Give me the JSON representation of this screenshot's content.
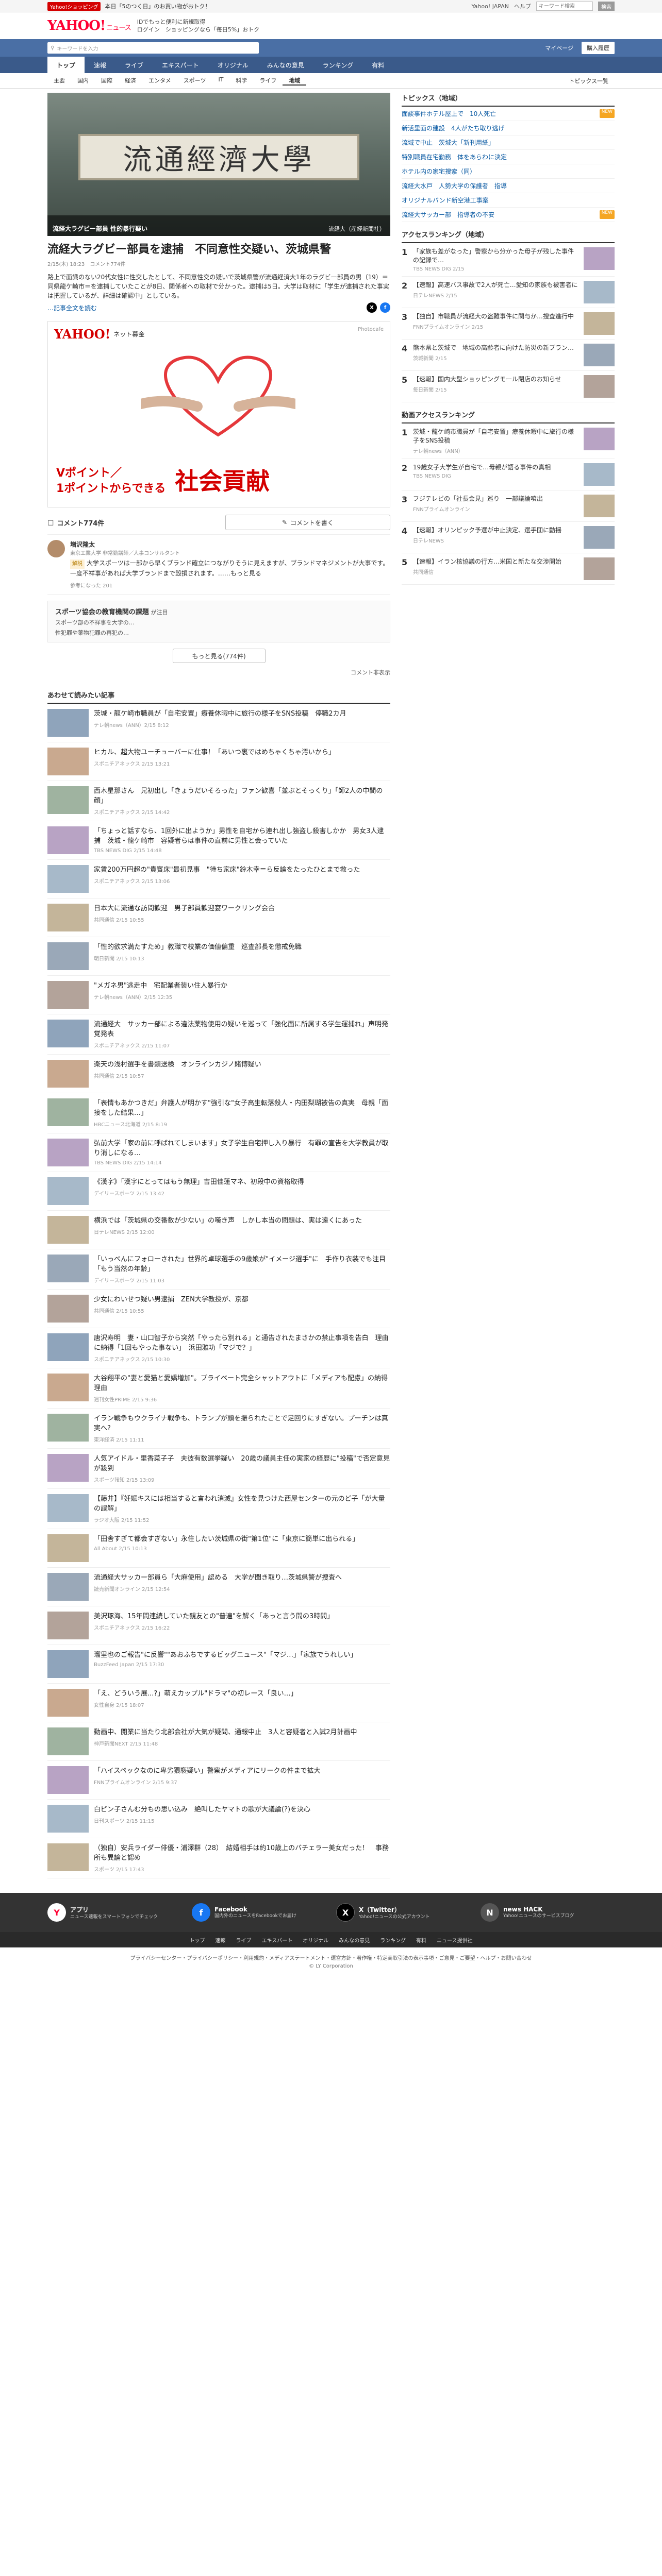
{
  "promo": {
    "tag": "Yahoo!ショッピング",
    "text": "本日「5のつく日」のお買い物がおトク！",
    "links": [
      "Yahoo! JAPAN",
      "ヘルプ"
    ],
    "search_placeholder": "キーワード検索",
    "search_button": "検索"
  },
  "masthead": {
    "logo": "YAHOO!",
    "logo_sub": "ニュース",
    "line1": "IDでもっと便利に新規取得",
    "line2": "ログイン　ショッピングなら「毎日5%」おトク"
  },
  "header": {
    "search_placeholder": "キーワードを入力",
    "mypage": "マイページ",
    "signup": "購入履歴"
  },
  "tabs": [
    "トップ",
    "速報",
    "ライブ",
    "エキスパート",
    "オリジナル",
    "みんなの意見",
    "ランキング",
    "有料"
  ],
  "subnav": {
    "items": [
      "主要",
      "国内",
      "国際",
      "経済",
      "エンタメ",
      "スポーツ",
      "IT",
      "科学",
      "ライフ",
      "地域"
    ],
    "right": "トピックス一覧"
  },
  "hero": {
    "sign": "流通經濟大學",
    "caption": "流経大ラグビー部員 性的暴行疑い",
    "credit": "流経大（産経新聞社）"
  },
  "article": {
    "title": "流経大ラグビー部員を逮捕　不同意性交疑い、茨城県警",
    "date": "2/15(木) 18:23",
    "comments": "コメント774件",
    "body": "路上で面識のない20代女性に性交したとして、不同意性交の疑いで茨城県警が流通経済大1年のラグビー部員の男（19）＝同県龍ケ崎市＝を逮捕していたことが8日、関係者への取材で分かった。逮捕は5日。大学は取材に「学生が逮捕された事実は把握しているが、詳細は確認中」としている。",
    "more": "…記事全文を読む"
  },
  "ad": {
    "logo": "YAHOO!",
    "sub": "ネット募金",
    "credit": "Photocafe",
    "point_label": "Vポイント／",
    "point_text": "1ポイントからできる",
    "big": "社会貢献"
  },
  "comments": {
    "label": "コメント774件",
    "button": "コメントを書く",
    "items": [
      {
        "name": "増沢隆太",
        "role": "東京工業大学 非常勤講師／人事コンサルタント",
        "tag": "解説",
        "body": "大学スポーツは一部から早くブランド確立につながりそうに見えますが、ブランドマネジメントが大事です。一度不祥事があれば大学ブランドまで毀損されます。……もっと見る",
        "likes": "参考になった 201"
      }
    ],
    "summary_title": "スポーツ協会の教育機関の課題",
    "summary_sub": "が注目",
    "summary_items": [
      "スポーツ部の不祥事を大学の…",
      "性犯罪や薬物犯罪の再犯の…"
    ],
    "more": "もっと見る(774件)",
    "hide": "コメント非表示"
  },
  "related": {
    "title": "あわせて読みたい記事",
    "items": [
      {
        "title": "茨城・龍ケ崎市職員が「自宅安置」療養休暇中に旅行の様子をSNS投稿　停職2カ月",
        "meta": "テレ朝news（ANN）2/15 8:12"
      },
      {
        "title": "ヒカル、超大物ユーチューバーに仕事！「あいつ裏ではめちゃくちゃ汚いから」",
        "meta": "スポニチアネックス 2/15 13:21"
      },
      {
        "title": "西木星那さん　兄初出し「きょうだいそろった」ファン歓喜「並ぶとそっくり」「師2人の中間の顔」",
        "meta": "スポニチアネックス 2/15 14:42"
      },
      {
        "title": "「ちょっと話すなら、1回外に出ようか」男性を自宅から連れ出し強盗し殺害しかか　男女3人逮捕　茨城・龍ケ崎市　容疑者らは事件の直前に男性と会っていた",
        "meta": "TBS NEWS DIG 2/15 14:48"
      },
      {
        "title": "家賃200万円超の\"貴賓床\"最初見事　\"待ち家床\"鈴木幸＝ら反論をたったひとまで救った",
        "meta": "スポニチアネックス 2/15 13:06"
      },
      {
        "title": "日本大に流通な訪問歓迎　男子部員歓迎宴ワークリング会合",
        "meta": "共同通信 2/15 10:55"
      },
      {
        "title": "「性的欲求満たすため」教職で校業の価値偏重　巡査部長を懲戒免職",
        "meta": "朝日新聞 2/15 10:13"
      },
      {
        "title": "\"メガネ男\"逃走中　宅配業者装い住人暴行か",
        "meta": "テレ朝news（ANN）2/15 12:35"
      },
      {
        "title": "流通経大　サッカー部による違法薬物使用の疑いを巡って「強化面に所属する学生運捕れ」声明発覚発表",
        "meta": "スポニチアネックス 2/15 11:07"
      },
      {
        "title": "楽天の浅村選手を書類送検　オンラインカジノ賭博疑い",
        "meta": "共同通信 2/15 10:57"
      },
      {
        "title": "「表情もあかつきだ」弁護人が明かす\"強引な\"女子高生転落殺人・内田梨瑚被告の真実　母親「面接をした結果…」",
        "meta": "HBCニュース北海道 2/15 8:19"
      },
      {
        "title": "弘前大学「家の前に呼ばれてしまいます」女子学生自宅押し入り暴行　有罪の宣告を大学教員が取り消しになる…",
        "meta": "TBS NEWS DIG 2/15 14:14"
      },
      {
        "title": "《漢字》「漢字にとってはもう無理」吉田佳蓮マネ、初段中の資格取得",
        "meta": "デイリースポーツ 2/15 13:42"
      },
      {
        "title": "横浜では「茨城県の交番数が少ない」の嘆き声　しかし本当の問題は、実は遠くにあった",
        "meta": "日テレNEWS 2/15 12:00"
      },
      {
        "title": "「いっぺんにフォローされた」世界的卓球選手の9歳娘が\"イメージ選手\"に　手作り衣装でも注目「もう当然の年齢」",
        "meta": "デイリースポーツ 2/15 11:03"
      },
      {
        "title": "少女にわいせつ疑い男逮捕　ZEN大学教授が、京都",
        "meta": "共同通信 2/15 10:55"
      },
      {
        "title": "唐沢寿明　妻・山口智子から突然「やったら別れる」と通告されたまさかの禁止事項を告白　理由に納得「1回もやった事ない」　浜田雅功「マジで？」",
        "meta": "スポニチアネックス 2/15 10:30"
      },
      {
        "title": "大谷翔平の\"妻と愛猫と愛嬌増加\"。プライベート完全シャットアウトに「メディアも配慮」の納得理由",
        "meta": "週刊女性PRIME 2/15 9:36"
      },
      {
        "title": "イラン戦争もウクライナ戦争も、トランプが頭を振られたことで足回りにすぎない。プーチンは真実へ?",
        "meta": "東洋経済 2/15 11:11"
      },
      {
        "title": "人気アイドル・里香菜子子　夫彼有数選挙疑い　20歳の議員主任の実家の経歴に\"投稿\"で否定意見が殺到",
        "meta": "スポーツ報知 2/15 13:09"
      },
      {
        "title": "【藤井】『妊娠キスには相当すると言われ消滅』女性を見つけた西屋センターの元のど子「が大量の誤解」",
        "meta": "ラジオ大阪 2/15 11:52"
      },
      {
        "title": "「田舎すぎて都会すぎない」永住したい茨城県の街\"第1位\"に「東京に簡単に出られる」",
        "meta": "All About 2/15 10:13"
      },
      {
        "title": "流通経大サッカー部員ら「大麻使用」認める　大学が聞き取り…茨城県警が捜査へ",
        "meta": "読売新聞オンライン 2/15 12:54"
      },
      {
        "title": "美沢琢海、15年間連続していた親友との\"普遍\"を解く「あっと言う間の3時間」",
        "meta": "スポニチアネックス 2/15 16:22"
      },
      {
        "title": "瑠里也のご報告\"に反響\"\"あおふちでするビッグニュース\"「マジ…」「家族でうれしい」",
        "meta": "BuzzFeed Japan 2/15 17:30"
      },
      {
        "title": "「え、どういう展...?」萌えカップル\"ドラマ\"の初レース「良い…」",
        "meta": "女性自身 2/15 18:07"
      },
      {
        "title": "動画中、開業に当たり北部会社が大気が疑問、通報中止　3人と容疑者と入試2月計画中",
        "meta": "神戸新聞NEXT 2/15 11:48"
      },
      {
        "title": "「ハイスペックなのに卑劣猥褻疑い」警察がメディアにリークの件まで拡大",
        "meta": "FNNプライムオンライン 2/15 9:37"
      },
      {
        "title": "白ピン子さんむ分もの思い込み　絶叫したヤマトの歌が大議論(?)を決心",
        "meta": "日刊スポーツ 2/15 11:15"
      },
      {
        "title": "（独自）安兵ライダー俳優・浦澤群（28）　結婚相手は約10歳上のバチェラー美女だった！　事務所も異論と認め",
        "meta": "スポーツ 2/15 17:43"
      }
    ]
  },
  "side": {
    "topics_title": "トピックス（地域）",
    "topics": [
      {
        "label": "面談事件ホテル屋上で　10人死亡",
        "badge": "NEW"
      },
      {
        "label": "新活里面の建設　4人がたち取り逃げ",
        "badge": ""
      },
      {
        "label": "流域で中止　茨城大「新刊用紙」",
        "badge": ""
      },
      {
        "label": "特別職員在宅勤務　体をあらわに決定",
        "badge": ""
      },
      {
        "label": "ホテル内の家宅捜索（同）",
        "badge": ""
      },
      {
        "label": "流経大水戸　人勢大学の保護者　指導",
        "badge": ""
      },
      {
        "label": "オリジナルバンド新空港工事案",
        "badge": ""
      },
      {
        "label": "流経大サッカー部　指導者の不安",
        "badge": "NEW"
      }
    ],
    "access_title": "アクセスランキング（地域）",
    "access": [
      {
        "title": "「家族も差がなった」警察から分かった母子が残した事件の記録で…",
        "meta": "TBS NEWS DIG 2/15"
      },
      {
        "title": "【速報】高速バス事故で2人が死亡…愛知の家族も被害者に",
        "meta": "日テレNEWS 2/15"
      },
      {
        "title": "【独自】市職員が流経大の盗難事件に関与か…捜査進行中",
        "meta": "FNNプライムオンライン 2/15"
      },
      {
        "title": "熊本県と茨城で　地域の高齢者に向けた防災の新プラン…",
        "meta": "茨城新聞 2/15"
      },
      {
        "title": "【速報】国内大型ショッピングモール閉店のお知らせ",
        "meta": "毎日新聞 2/15"
      }
    ],
    "video_title": "動画アクセスランキング",
    "video": [
      {
        "title": "茨城・龍ケ崎市職員が「自宅安置」療養休暇中に旅行の様子をSNS投稿",
        "meta": "テレ朝news（ANN）"
      },
      {
        "title": "19歳女子大学生が自宅で…母親が語る事件の真相",
        "meta": "TBS NEWS DIG"
      },
      {
        "title": "フジテレビの「社長会見」巡り　一部議論噴出",
        "meta": "FNNプライムオンライン"
      },
      {
        "title": "【速報】オリンピック予選が中止決定、選手団に動揺",
        "meta": "日テレNEWS"
      },
      {
        "title": "【速報】イラン核協議の行方…米国と新たな交渉開始",
        "meta": "共同通信"
      }
    ]
  },
  "footer": {
    "blocks": [
      {
        "name": "アプリ",
        "desc": "ニュース速報をスマートフォンでチェック"
      },
      {
        "name": "Facebook",
        "desc": "国内外のニュースをFacebookでお届け"
      },
      {
        "name": "X（Twitter）",
        "desc": "Yahoo!ニュースの公式アカウント"
      },
      {
        "name": "news HACK",
        "desc": "Yahoo!ニュースのサービスブログ"
      }
    ],
    "nav": [
      "トップ",
      "速報",
      "ライブ",
      "エキスパート",
      "オリジナル",
      "みんなの意見",
      "ランキング",
      "有料",
      "ニュース提供社"
    ],
    "legal": "プライバシーセンター・プライバシーポリシー・利用規約・メディアステートメント・運営方針・著作権・特定商取引法の表示事項・ご意見・ご要望・ヘルプ・お問い合わせ",
    "copy": "© LY Corporation"
  }
}
